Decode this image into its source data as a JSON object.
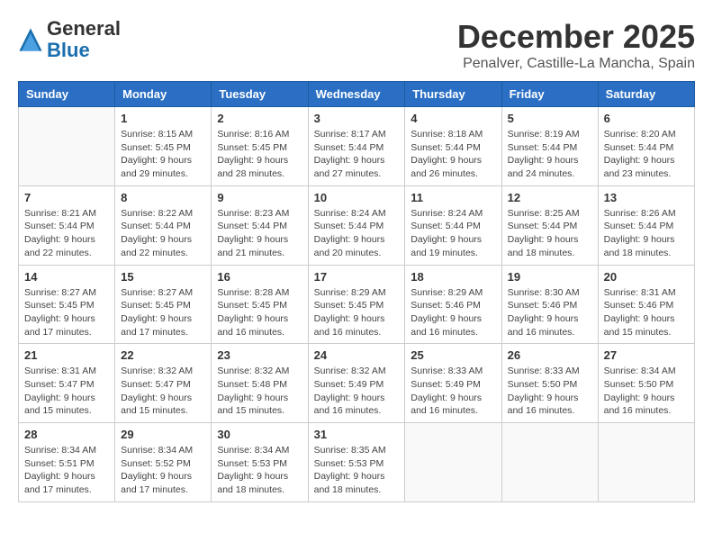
{
  "header": {
    "logo_line1": "General",
    "logo_line2": "Blue",
    "month_title": "December 2025",
    "location": "Penalver, Castille-La Mancha, Spain"
  },
  "days_of_week": [
    "Sunday",
    "Monday",
    "Tuesday",
    "Wednesday",
    "Thursday",
    "Friday",
    "Saturday"
  ],
  "weeks": [
    [
      {
        "day": "",
        "sunrise": "",
        "sunset": "",
        "daylight": ""
      },
      {
        "day": "1",
        "sunrise": "Sunrise: 8:15 AM",
        "sunset": "Sunset: 5:45 PM",
        "daylight": "Daylight: 9 hours and 29 minutes."
      },
      {
        "day": "2",
        "sunrise": "Sunrise: 8:16 AM",
        "sunset": "Sunset: 5:45 PM",
        "daylight": "Daylight: 9 hours and 28 minutes."
      },
      {
        "day": "3",
        "sunrise": "Sunrise: 8:17 AM",
        "sunset": "Sunset: 5:44 PM",
        "daylight": "Daylight: 9 hours and 27 minutes."
      },
      {
        "day": "4",
        "sunrise": "Sunrise: 8:18 AM",
        "sunset": "Sunset: 5:44 PM",
        "daylight": "Daylight: 9 hours and 26 minutes."
      },
      {
        "day": "5",
        "sunrise": "Sunrise: 8:19 AM",
        "sunset": "Sunset: 5:44 PM",
        "daylight": "Daylight: 9 hours and 24 minutes."
      },
      {
        "day": "6",
        "sunrise": "Sunrise: 8:20 AM",
        "sunset": "Sunset: 5:44 PM",
        "daylight": "Daylight: 9 hours and 23 minutes."
      }
    ],
    [
      {
        "day": "7",
        "sunrise": "Sunrise: 8:21 AM",
        "sunset": "Sunset: 5:44 PM",
        "daylight": "Daylight: 9 hours and 22 minutes."
      },
      {
        "day": "8",
        "sunrise": "Sunrise: 8:22 AM",
        "sunset": "Sunset: 5:44 PM",
        "daylight": "Daylight: 9 hours and 22 minutes."
      },
      {
        "day": "9",
        "sunrise": "Sunrise: 8:23 AM",
        "sunset": "Sunset: 5:44 PM",
        "daylight": "Daylight: 9 hours and 21 minutes."
      },
      {
        "day": "10",
        "sunrise": "Sunrise: 8:24 AM",
        "sunset": "Sunset: 5:44 PM",
        "daylight": "Daylight: 9 hours and 20 minutes."
      },
      {
        "day": "11",
        "sunrise": "Sunrise: 8:24 AM",
        "sunset": "Sunset: 5:44 PM",
        "daylight": "Daylight: 9 hours and 19 minutes."
      },
      {
        "day": "12",
        "sunrise": "Sunrise: 8:25 AM",
        "sunset": "Sunset: 5:44 PM",
        "daylight": "Daylight: 9 hours and 18 minutes."
      },
      {
        "day": "13",
        "sunrise": "Sunrise: 8:26 AM",
        "sunset": "Sunset: 5:44 PM",
        "daylight": "Daylight: 9 hours and 18 minutes."
      }
    ],
    [
      {
        "day": "14",
        "sunrise": "Sunrise: 8:27 AM",
        "sunset": "Sunset: 5:45 PM",
        "daylight": "Daylight: 9 hours and 17 minutes."
      },
      {
        "day": "15",
        "sunrise": "Sunrise: 8:27 AM",
        "sunset": "Sunset: 5:45 PM",
        "daylight": "Daylight: 9 hours and 17 minutes."
      },
      {
        "day": "16",
        "sunrise": "Sunrise: 8:28 AM",
        "sunset": "Sunset: 5:45 PM",
        "daylight": "Daylight: 9 hours and 16 minutes."
      },
      {
        "day": "17",
        "sunrise": "Sunrise: 8:29 AM",
        "sunset": "Sunset: 5:45 PM",
        "daylight": "Daylight: 9 hours and 16 minutes."
      },
      {
        "day": "18",
        "sunrise": "Sunrise: 8:29 AM",
        "sunset": "Sunset: 5:46 PM",
        "daylight": "Daylight: 9 hours and 16 minutes."
      },
      {
        "day": "19",
        "sunrise": "Sunrise: 8:30 AM",
        "sunset": "Sunset: 5:46 PM",
        "daylight": "Daylight: 9 hours and 16 minutes."
      },
      {
        "day": "20",
        "sunrise": "Sunrise: 8:31 AM",
        "sunset": "Sunset: 5:46 PM",
        "daylight": "Daylight: 9 hours and 15 minutes."
      }
    ],
    [
      {
        "day": "21",
        "sunrise": "Sunrise: 8:31 AM",
        "sunset": "Sunset: 5:47 PM",
        "daylight": "Daylight: 9 hours and 15 minutes."
      },
      {
        "day": "22",
        "sunrise": "Sunrise: 8:32 AM",
        "sunset": "Sunset: 5:47 PM",
        "daylight": "Daylight: 9 hours and 15 minutes."
      },
      {
        "day": "23",
        "sunrise": "Sunrise: 8:32 AM",
        "sunset": "Sunset: 5:48 PM",
        "daylight": "Daylight: 9 hours and 15 minutes."
      },
      {
        "day": "24",
        "sunrise": "Sunrise: 8:32 AM",
        "sunset": "Sunset: 5:49 PM",
        "daylight": "Daylight: 9 hours and 16 minutes."
      },
      {
        "day": "25",
        "sunrise": "Sunrise: 8:33 AM",
        "sunset": "Sunset: 5:49 PM",
        "daylight": "Daylight: 9 hours and 16 minutes."
      },
      {
        "day": "26",
        "sunrise": "Sunrise: 8:33 AM",
        "sunset": "Sunset: 5:50 PM",
        "daylight": "Daylight: 9 hours and 16 minutes."
      },
      {
        "day": "27",
        "sunrise": "Sunrise: 8:34 AM",
        "sunset": "Sunset: 5:50 PM",
        "daylight": "Daylight: 9 hours and 16 minutes."
      }
    ],
    [
      {
        "day": "28",
        "sunrise": "Sunrise: 8:34 AM",
        "sunset": "Sunset: 5:51 PM",
        "daylight": "Daylight: 9 hours and 17 minutes."
      },
      {
        "day": "29",
        "sunrise": "Sunrise: 8:34 AM",
        "sunset": "Sunset: 5:52 PM",
        "daylight": "Daylight: 9 hours and 17 minutes."
      },
      {
        "day": "30",
        "sunrise": "Sunrise: 8:34 AM",
        "sunset": "Sunset: 5:53 PM",
        "daylight": "Daylight: 9 hours and 18 minutes."
      },
      {
        "day": "31",
        "sunrise": "Sunrise: 8:35 AM",
        "sunset": "Sunset: 5:53 PM",
        "daylight": "Daylight: 9 hours and 18 minutes."
      },
      {
        "day": "",
        "sunrise": "",
        "sunset": "",
        "daylight": ""
      },
      {
        "day": "",
        "sunrise": "",
        "sunset": "",
        "daylight": ""
      },
      {
        "day": "",
        "sunrise": "",
        "sunset": "",
        "daylight": ""
      }
    ]
  ]
}
